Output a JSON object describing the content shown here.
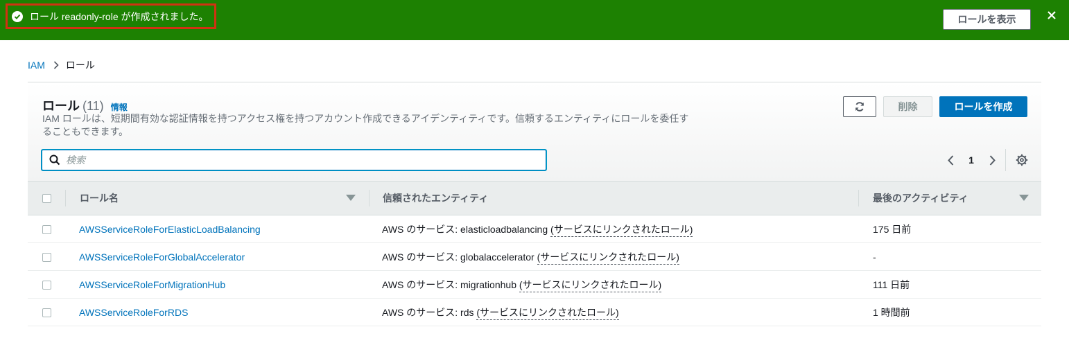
{
  "flash": {
    "message": "ロール readonly-role が作成されました。",
    "view_button": "ロールを表示",
    "close": "✕"
  },
  "breadcrumb": {
    "root": "IAM",
    "current": "ロール"
  },
  "panel": {
    "title": "ロール",
    "count": "(11)",
    "info": "情報",
    "description": "IAM ロールは、短期間有効な認証情報を持つアクセス権を持つアカウント作成できるアイデンティティです。信頼するエンティティにロールを委任することもできます。",
    "delete_label": "削除",
    "create_label": "ロールを作成",
    "search_placeholder": "検索",
    "page_number": "1"
  },
  "table": {
    "columns": [
      "ロール名",
      "信頼されたエンティティ",
      "最後のアクティビティ"
    ],
    "rows": [
      {
        "name": "AWSServiceRoleForElasticLoadBalancing",
        "entity_prefix": "AWS のサービス: elasticloadbalancing ",
        "entity_link": "(サービスにリンクされたロール)",
        "activity": "175 日前"
      },
      {
        "name": "AWSServiceRoleForGlobalAccelerator",
        "entity_prefix": "AWS のサービス: globalaccelerator ",
        "entity_link": "(サービスにリンクされたロール)",
        "activity": "-"
      },
      {
        "name": "AWSServiceRoleForMigrationHub",
        "entity_prefix": "AWS のサービス: migrationhub ",
        "entity_link": "(サービスにリンクされたロール)",
        "activity": "111 日前"
      },
      {
        "name": "AWSServiceRoleForRDS",
        "entity_prefix": "AWS のサービス: rds ",
        "entity_link": "(サービスにリンクされたロール)",
        "activity": "1 時間前"
      }
    ]
  },
  "colors": {
    "flash_bg": "#1d8102",
    "primary": "#0073bb",
    "highlight_border": "#d13212"
  },
  "icons": {
    "success": "check-circle-icon",
    "close": "close-icon",
    "breadcrumb_sep": "chevron-right-icon",
    "refresh": "refresh-icon",
    "search": "search-icon",
    "prev": "chevron-left-icon",
    "next": "chevron-right-icon",
    "settings": "gear-icon",
    "sort": "caret-down-icon"
  }
}
